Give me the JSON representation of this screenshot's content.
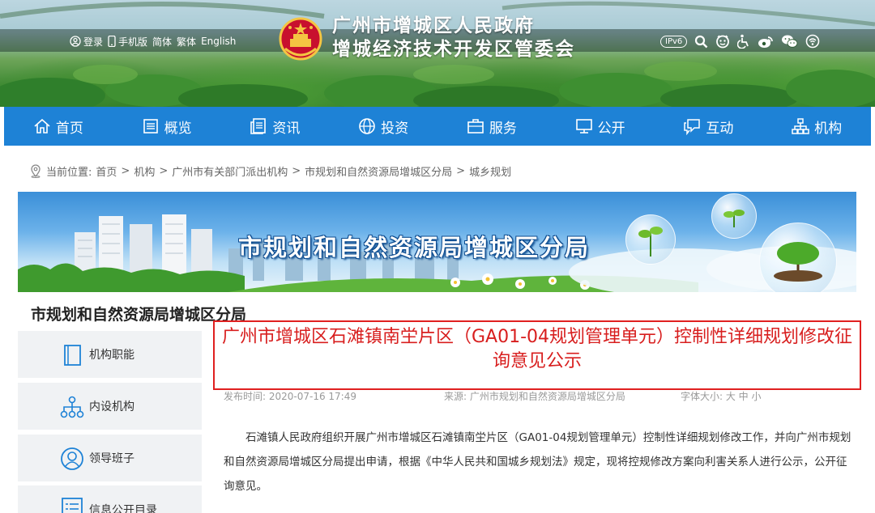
{
  "header": {
    "login": "登录",
    "mobile": "手机版",
    "simplified": "简体",
    "traditional": "繁体",
    "english": "English",
    "title_line1": "广州市增城区人民政府",
    "title_line2": "增城经济技术开发区管委会",
    "ipv6": "IPv6",
    "right_icons": [
      "search-icon",
      "face-icon",
      "accessibility-icon",
      "weibo-icon",
      "wechat-icon",
      "audio-icon"
    ]
  },
  "nav": {
    "items": [
      {
        "label": "首页",
        "icon": "home-icon"
      },
      {
        "label": "概览",
        "icon": "overview-icon"
      },
      {
        "label": "资讯",
        "icon": "news-icon"
      },
      {
        "label": "投资",
        "icon": "globe-icon"
      },
      {
        "label": "服务",
        "icon": "briefcase-icon"
      },
      {
        "label": "公开",
        "icon": "monitor-icon"
      },
      {
        "label": "互动",
        "icon": "chat-icon"
      },
      {
        "label": "机构",
        "icon": "org-icon"
      }
    ]
  },
  "breadcrumb": {
    "prefix": "当前位置:",
    "items": [
      "首页",
      "机构",
      "广州市有关部门派出机构",
      "市规划和自然资源局增城区分局",
      "城乡规划"
    ],
    "separator": ">"
  },
  "banner": {
    "title": "市规划和自然资源局增城区分局"
  },
  "sidebar": {
    "title": "市规划和自然资源局增城区分局",
    "items": [
      {
        "label": "机构职能",
        "icon": "document-icon"
      },
      {
        "label": "内设机构",
        "icon": "org-chart-icon"
      },
      {
        "label": "领导班子",
        "icon": "person-icon"
      },
      {
        "label": "信息公开目录",
        "icon": "list-icon"
      }
    ]
  },
  "article": {
    "title": "广州市增城区石滩镇南坣片区（GA01-04规划管理单元）控制性详细规划修改征询意见公示",
    "publish_time": "发布时间: 2020-07-16 17:49",
    "source": "来源: 广州市规划和自然资源局增城区分局",
    "font_size_label": "字体大小: 大 中 小",
    "body": "石滩镇人民政府组织开展广州市增城区石滩镇南坣片区（GA01-04规划管理单元）控制性详细规划修改工作，并向广州市规划和自然资源局增城区分局提出申请，根据《中华人民共和国城乡规划法》规定，现将控规修改方案向利害关系人进行公示，公开征询意见。"
  },
  "colors": {
    "nav_bg": "#1e82d6",
    "highlight_border": "#e02020",
    "title_red": "#d81e1e",
    "sidebar_icon": "#1e82d6"
  }
}
